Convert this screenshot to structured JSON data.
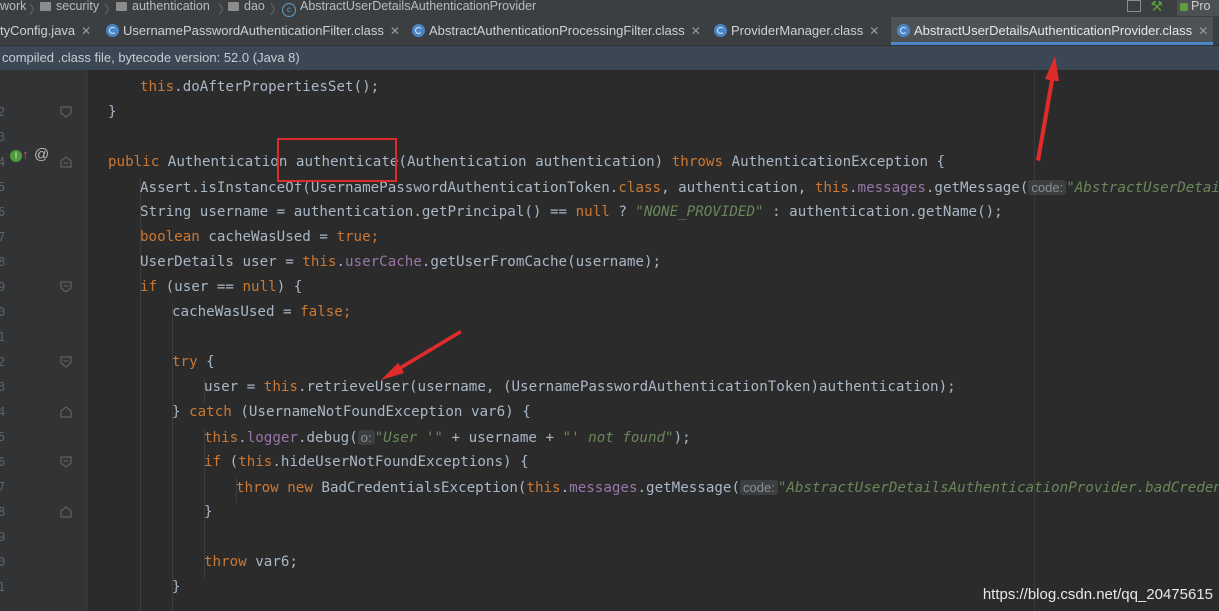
{
  "breadcrumb": {
    "items": [
      "work",
      "security",
      "authentication",
      "dao",
      "AbstractUserDetailsAuthenticationProvider"
    ]
  },
  "toolbar": {
    "run_label": "Pro"
  },
  "tabs": [
    {
      "label": "tyConfig.java",
      "active": false
    },
    {
      "label": "UsernamePasswordAuthenticationFilter.class",
      "active": false
    },
    {
      "label": "AbstractAuthenticationProcessingFilter.class",
      "active": false
    },
    {
      "label": "ProviderManager.class",
      "active": false
    },
    {
      "label": "AbstractUserDetailsAuthenticationProvider.class",
      "active": true
    }
  ],
  "banner": {
    "text": "compiled .class file, bytecode version: 52.0 (Java 8)"
  },
  "gutter": {
    "line_numbers": [
      "",
      "2",
      "3",
      "4",
      "5",
      "6",
      "7",
      "8",
      "9",
      "0",
      "1",
      "2",
      "3",
      "4",
      "5",
      "6",
      "7",
      "8",
      "9",
      "0",
      "1"
    ]
  },
  "code": {
    "l1_this": "this",
    "l1_rest": ".doAfterPropertiesSet();",
    "l2": "}",
    "l4_public": "public",
    "l4_type": " Authentication ",
    "l4_method": "authenticate",
    "l4_params": "(Authentication authentication) ",
    "l4_throws": "throws",
    "l4_exc": " AuthenticationException {",
    "l5_a": "Assert.isInstanceOf(UsernamePasswordAuthenticationToken.",
    "l5_class": "class",
    "l5_b": ", authentication, ",
    "l5_this": "this",
    "l5_dot": ".",
    "l5_messages": "messages",
    "l5_c": ".getMessage(",
    "l5_hint": "code:",
    "l5_str": "\"AbstractUserDetailsAuth",
    "l6_a": "String username = authentication.getPrincipal() == ",
    "l6_null": "null",
    "l6_b": " ? ",
    "l6_str": "\"NONE_PROVIDED\"",
    "l6_c": " : authentication.getName();",
    "l7_boolean": "boolean",
    "l7_a": " cacheWasUsed = ",
    "l7_true": "true",
    "l7_semi": ";",
    "l8_a": "UserDetails user = ",
    "l8_this": "this",
    "l8_dot": ".",
    "l8_field": "userCache",
    "l8_b": ".getUserFromCache(username);",
    "l9_if": "if",
    "l9_a": " (user == ",
    "l9_null": "null",
    "l9_b": ") {",
    "l10_a": "cacheWasUsed = ",
    "l10_false": "false",
    "l10_semi": ";",
    "l12_try": "try",
    "l12_a": " {",
    "l13_a": "user = ",
    "l13_this": "this",
    "l13_b": ".retrieveUser(username, (UsernamePasswordAuthenticationToken)authentication);",
    "l14_a": "} ",
    "l14_catch": "catch",
    "l14_b": " (UsernameNotFoundException var6) {",
    "l15_this": "this",
    "l15_dot": ".",
    "l15_logger": "logger",
    "l15_a": ".debug(",
    "l15_hint": "o:",
    "l15_str1": "\"User '\"",
    "l15_b": " + username + ",
    "l15_str2": "\"' not found\"",
    "l15_c": ");",
    "l16_if": "if",
    "l16_a": " (",
    "l16_this": "this",
    "l16_b": ".hideUserNotFoundExceptions) {",
    "l17_throw": "throw",
    "l17_new": " new",
    "l17_a": " BadCredentialsException(",
    "l17_this": "this",
    "l17_dot": ".",
    "l17_messages": "messages",
    "l17_b": ".getMessage(",
    "l17_hint": "code:",
    "l17_str": "\"AbstractUserDetailsAuthenticationProvider.badCredentials",
    "l18": "}",
    "l20_throw": "throw",
    "l20_a": " var6;",
    "l21": "}"
  },
  "watermark": "https://blog.csdn.net/qq_20475615",
  "colors": {
    "background": "#2b2b2b",
    "keyword": "#cc7832",
    "string": "#6a8759",
    "field": "#9876aa",
    "annotation_red": "#e02b2b"
  }
}
